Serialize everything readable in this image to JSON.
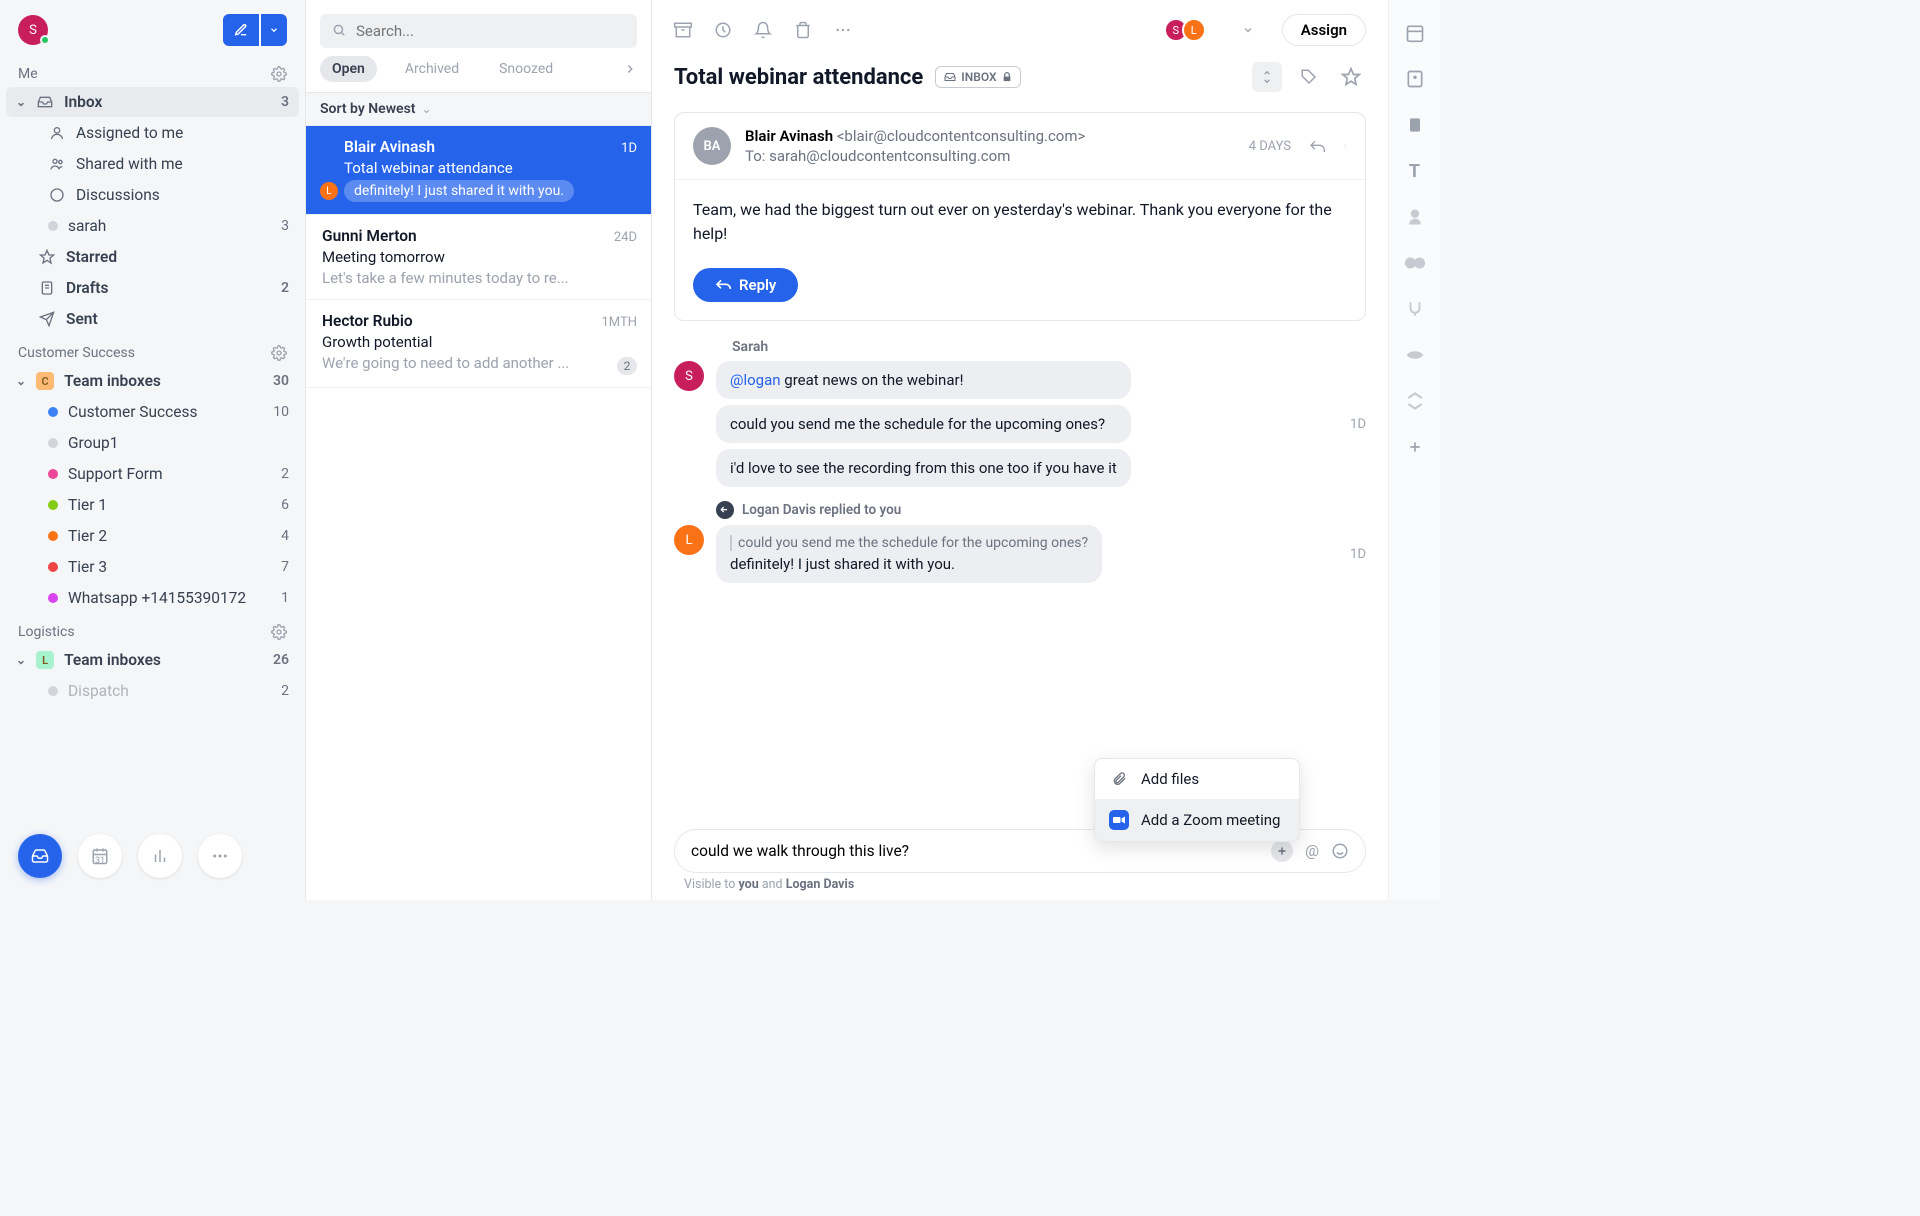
{
  "sidebar": {
    "sections": [
      {
        "title": "Me",
        "items": [
          {
            "label": "Inbox",
            "count": "3",
            "level": 0,
            "icon": "inbox",
            "expanded": true,
            "active": true
          },
          {
            "label": "Assigned to me",
            "count": "",
            "level": 1,
            "icon": "user"
          },
          {
            "label": "Shared with me",
            "count": "",
            "level": 1,
            "icon": "users"
          },
          {
            "label": "Discussions",
            "count": "",
            "level": 1,
            "icon": "chat"
          },
          {
            "label": "sarah",
            "count": "3",
            "level": 1,
            "icon": "dot",
            "dotColor": "#d1d5db"
          },
          {
            "label": "Starred",
            "count": "",
            "level": 0,
            "icon": "star"
          },
          {
            "label": "Drafts",
            "count": "2",
            "level": 0,
            "icon": "draft"
          },
          {
            "label": "Sent",
            "count": "",
            "level": 0,
            "icon": "sent"
          }
        ]
      },
      {
        "title": "Customer Success",
        "items": [
          {
            "label": "Team inboxes",
            "count": "30",
            "level": 0,
            "icon": "sq",
            "sqColor": "#fdba74",
            "sqText": "C",
            "expanded": true
          },
          {
            "label": "Customer Success",
            "count": "10",
            "level": 1,
            "icon": "dot",
            "dotColor": "#3b82f6"
          },
          {
            "label": "Group1",
            "count": "",
            "level": 1,
            "icon": "dot",
            "dotColor": "#d1d5db"
          },
          {
            "label": "Support Form",
            "count": "2",
            "level": 1,
            "icon": "dot",
            "dotColor": "#ec4899"
          },
          {
            "label": "Tier 1",
            "count": "6",
            "level": 1,
            "icon": "dot",
            "dotColor": "#84cc16"
          },
          {
            "label": "Tier 2",
            "count": "4",
            "level": 1,
            "icon": "dot",
            "dotColor": "#f97316"
          },
          {
            "label": "Tier 3",
            "count": "7",
            "level": 1,
            "icon": "dot",
            "dotColor": "#ef4444"
          },
          {
            "label": "Whatsapp +14155390172",
            "count": "1",
            "level": 1,
            "icon": "dot",
            "dotColor": "#d946ef"
          }
        ]
      },
      {
        "title": "Logistics",
        "items": [
          {
            "label": "Team inboxes",
            "count": "26",
            "level": 0,
            "icon": "sq",
            "sqColor": "#a7f3d0",
            "sqText": "L",
            "expanded": true
          },
          {
            "label": "Dispatch",
            "count": "2",
            "level": 1,
            "icon": "dot",
            "dotColor": "#d1d5db",
            "muted": true
          }
        ]
      }
    ]
  },
  "search": {
    "placeholder": "Search..."
  },
  "tabs": [
    {
      "label": "Open",
      "active": true
    },
    {
      "label": "Archived"
    },
    {
      "label": "Snoozed"
    }
  ],
  "sort": {
    "label": "Sort by Newest"
  },
  "messages": [
    {
      "from": "Blair Avinash",
      "subject": "Total webinar attendance",
      "preview": "definitely! I just shared it with you.",
      "time": "1D",
      "selected": true,
      "previewPill": true,
      "leftAvatar": "L",
      "leftAvatarColor": "#f97316"
    },
    {
      "from": "Gunni Merton",
      "subject": "Meeting tomorrow",
      "preview": "Let's take a few minutes today to re...",
      "time": "24D"
    },
    {
      "from": "Hector Rubio",
      "subject": "Growth potential",
      "preview": "We're going to need to add another ...",
      "time": "1MTH",
      "badge": "2"
    }
  ],
  "reading": {
    "subject": "Total webinar attendance",
    "inboxTag": "INBOX",
    "assignLabel": "Assign",
    "assignees": [
      {
        "letter": "S",
        "color": "#c81e5b"
      },
      {
        "letter": "L",
        "color": "#f97316"
      }
    ],
    "email": {
      "fromName": "Blair Avinash",
      "fromAddr": "<blair@cloudcontentconsulting.com>",
      "toLine": "To: sarah@cloudcontentconsulting.com",
      "avatarText": "BA",
      "time": "4 DAYS",
      "body": "Team, we had the biggest turn out ever on yesterday's webinar. Thank you everyone for the help!",
      "replyLabel": "Reply"
    },
    "commentsHeader": "Sarah",
    "comments": [
      {
        "author": "Sarah",
        "avatar": "S",
        "avatarColor": "#c81e5b",
        "time": "1D",
        "bubbles": [
          {
            "mention": "@logan",
            "text": " great news on the webinar!"
          },
          {
            "text": "could you send me the schedule for the upcoming ones?"
          },
          {
            "text": "i'd love to see the recording from this one too if you have it"
          }
        ]
      }
    ],
    "replyIndicator": "Logan Davis replied to you",
    "replyComment": {
      "avatar": "L",
      "avatarColor": "#f97316",
      "time": "1D",
      "quoted": "could you send me the schedule for the upcoming ones?",
      "text": "definitely! I just shared it with you."
    },
    "composer": {
      "value": "could we walk through this live?",
      "visibilityPrefix": "Visible to ",
      "visibilityYou": "you",
      "visibilityMid": " and ",
      "visibilityOther": "Logan Davis"
    },
    "popover": [
      {
        "label": "Add files",
        "icon": "paperclip"
      },
      {
        "label": "Add a Zoom meeting",
        "icon": "zoom",
        "hover": true
      }
    ]
  }
}
